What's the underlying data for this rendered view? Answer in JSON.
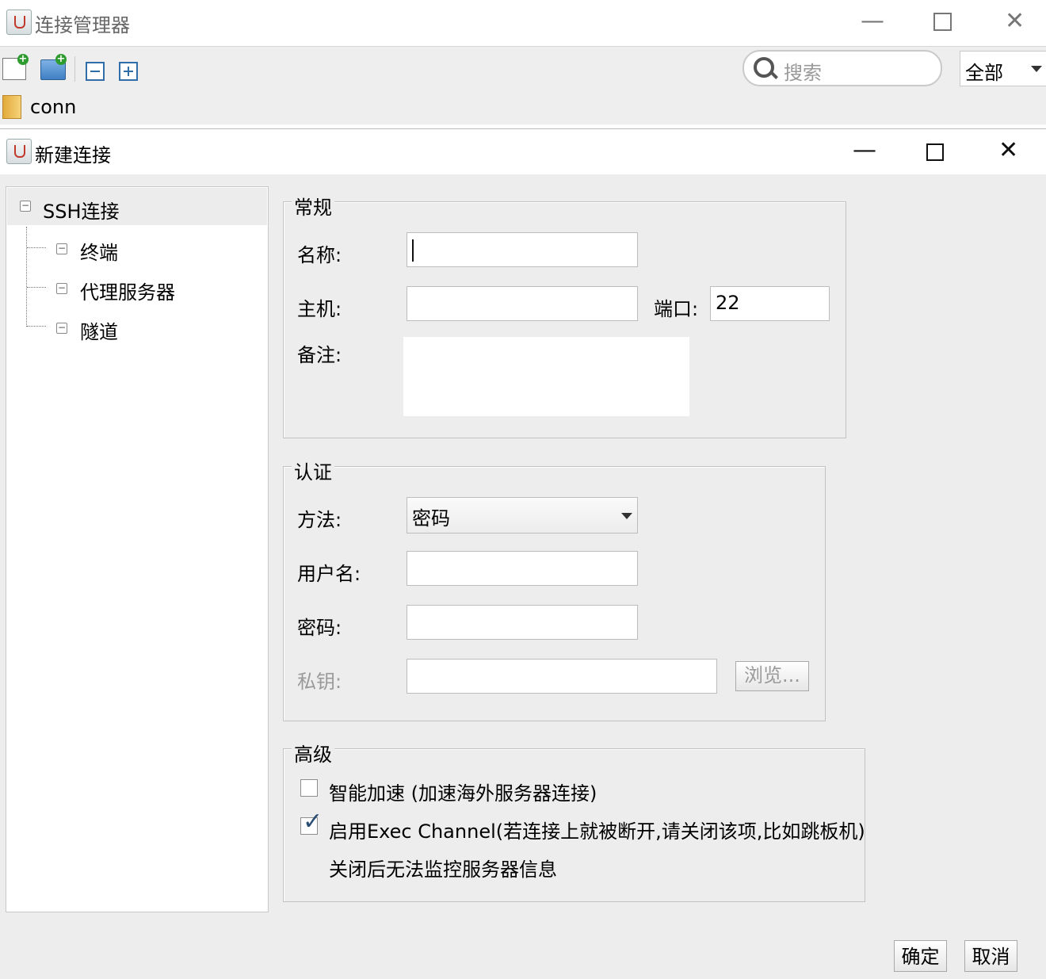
{
  "manager_window": {
    "title": "连接管理器",
    "toolbar": {
      "search_placeholder": "搜索",
      "scope_value": "全部"
    },
    "tree_root": "conn"
  },
  "dialog": {
    "title": "新建连接",
    "tree": {
      "root": "SSH连接",
      "children": [
        "终端",
        "代理服务器",
        "隧道"
      ]
    },
    "general": {
      "legend": "常规",
      "name_label": "名称:",
      "name_value": "",
      "host_label": "主机:",
      "host_value": "",
      "port_label": "端口:",
      "port_value": "22",
      "notes_label": "备注:",
      "notes_value": ""
    },
    "auth": {
      "legend": "认证",
      "method_label": "方法:",
      "method_value": "密码",
      "username_label": "用户名:",
      "username_value": "",
      "password_label": "密码:",
      "password_value": "",
      "privkey_label": "私钥:",
      "privkey_value": "",
      "browse_label": "浏览..."
    },
    "advanced": {
      "legend": "高级",
      "smart_accel_label": "智能加速 (加速海外服务器连接)",
      "smart_accel_checked": false,
      "exec_channel_label": "启用Exec Channel(若连接上就被断开,请关闭该项,比如跳板机)",
      "exec_channel_checked": true,
      "exec_channel_note": "关闭后无法监控服务器信息"
    },
    "ok_label": "确定",
    "cancel_label": "取消"
  }
}
